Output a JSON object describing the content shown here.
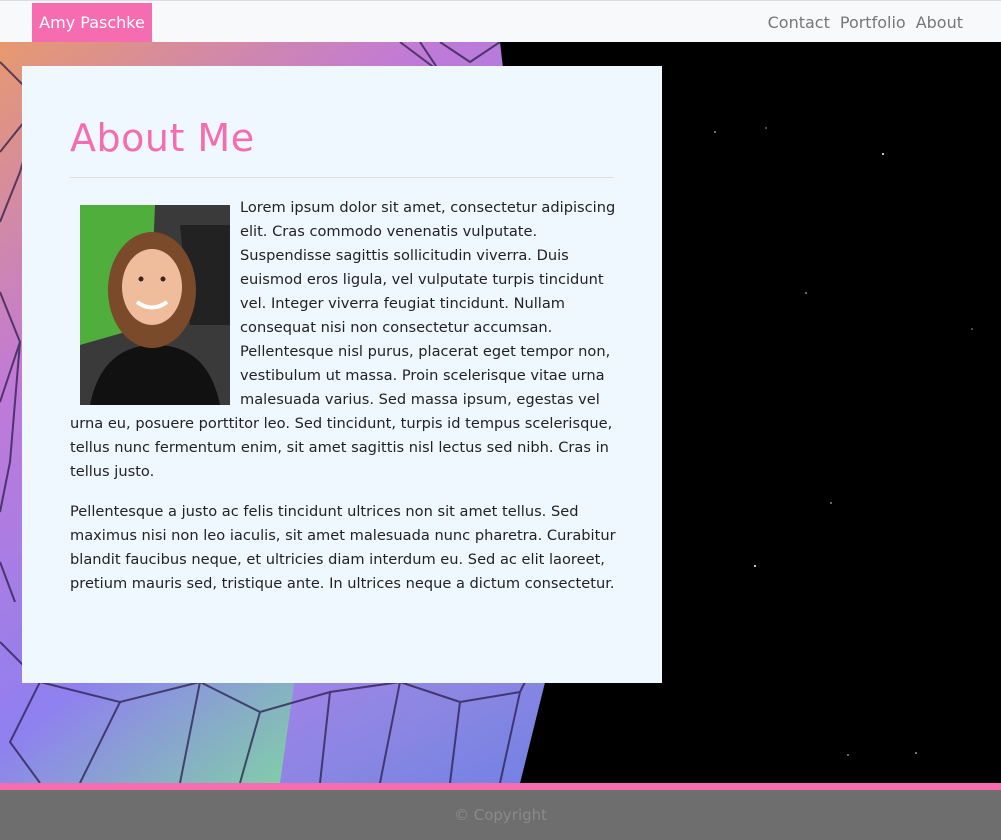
{
  "nav": {
    "brand": "Amy Paschke",
    "links": [
      "Contact",
      "Portfolio",
      "About"
    ]
  },
  "colors": {
    "accent": "#f56db0",
    "card_bg": "#f0f8ff",
    "footer_bg": "#6e6e6e"
  },
  "about": {
    "title": "About Me",
    "paragraph1": "Lorem ipsum dolor sit amet, consectetur adipiscing elit. Cras commodo venenatis vulputate. Suspendisse sagittis sollicitudin viverra. Duis euismod eros ligula, vel vulputate turpis tincidunt vel. Integer viverra feugiat tincidunt. Nullam consequat nisi non consectetur accumsan. Pellentesque nisl purus, placerat eget tempor non, vestibulum ut massa. Proin scelerisque vitae urna malesuada varius. Sed massa ipsum, egestas vel urna eu, posuere porttitor leo. Sed tincidunt, turpis id tempus scelerisque, tellus nunc fermentum enim, sit amet sagittis nisl lectus sed nibh. Cras in tellus justo.",
    "paragraph2": "Pellentesque a justo ac felis tincidunt ultrices non sit amet tellus. Sed maximus nisi non leo iaculis, sit amet malesuada nunc pharetra. Curabitur blandit faucibus neque, et ultricies diam interdum eu. Sed ac elit laoreet, pretium mauris sed, tristique ante. In ultrices neque a dictum consectetur."
  },
  "footer": {
    "text": "© Copyright"
  }
}
